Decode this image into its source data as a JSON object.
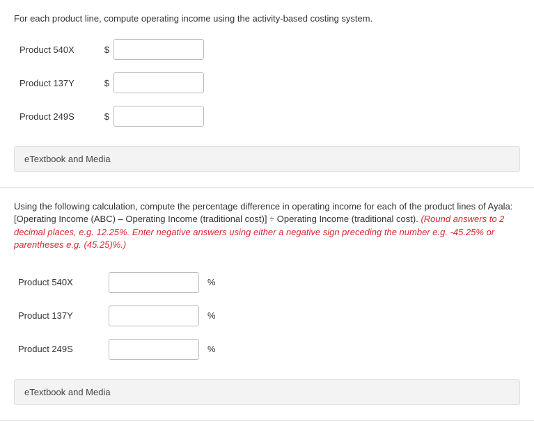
{
  "section1": {
    "instruction": "For each product line, compute operating income using the activity-based costing system.",
    "rows": [
      {
        "label": "Product 540X",
        "prefix": "$"
      },
      {
        "label": "Product 137Y",
        "prefix": "$"
      },
      {
        "label": "Product 249S",
        "prefix": "$"
      }
    ],
    "etextbook_label": "eTextbook and Media"
  },
  "section2": {
    "instruction_line1": "Using the following calculation, compute the percentage difference in operating income for each of the product lines of Ayala:",
    "instruction_line2_a": "[Operating Income (ABC) – Operating Income (traditional cost)] ÷ Operating Income (traditional cost). ",
    "instruction_red": "(Round answers to 2 decimal places, e.g. 12.25%. Enter negative answers using either a negative sign preceding the number e.g. -45.25% or parentheses e.g. (45.25)%.)",
    "rows": [
      {
        "label": "Product 540X",
        "suffix": "%"
      },
      {
        "label": "Product 137Y",
        "suffix": "%"
      },
      {
        "label": "Product 249S",
        "suffix": "%"
      }
    ],
    "etextbook_label": "eTextbook and Media"
  }
}
